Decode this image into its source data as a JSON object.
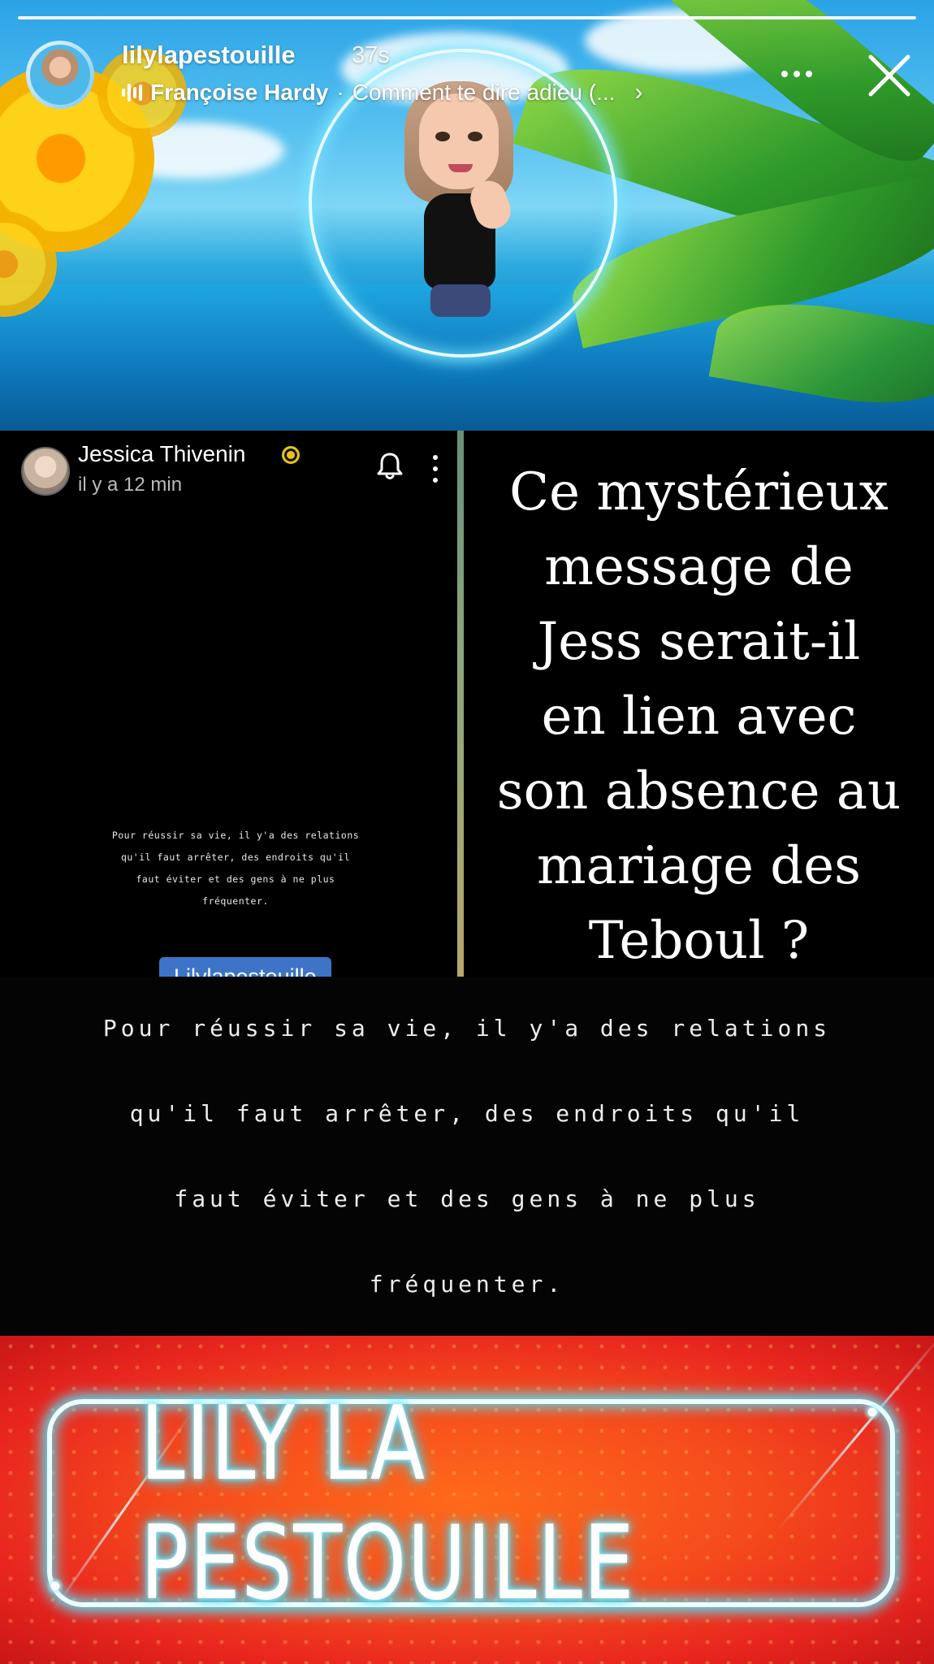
{
  "story": {
    "username": "lilylapestouille",
    "time_ago": "37s",
    "music": {
      "artist": "Françoise Hardy",
      "separator": "·",
      "title": "Comment te dire adieu (...",
      "chevron": "›"
    },
    "progress": 1.0
  },
  "snap_post": {
    "author": "Jessica Thivenin",
    "time": "il y a 12 min",
    "quote_lines": [
      "Pour réussir sa vie, il y'a des relations",
      "qu'il faut arrêter, des endroits qu'il",
      "faut éviter et des gens à ne plus",
      "fréquenter."
    ],
    "tag": "Lilylapestouille"
  },
  "headline": {
    "lines": [
      "Ce mystérieux",
      "message de",
      "Jess serait-il",
      "en lien avec",
      "son absence au",
      "mariage des",
      "Teboul ?"
    ]
  },
  "zoom_quote": {
    "lines": [
      "Pour réussir sa vie, il y'a des relations",
      "qu'il faut arrêter, des endroits qu'il",
      "faut éviter et des gens à ne plus",
      "fréquenter."
    ]
  },
  "footer": {
    "neon_text": "LILY LA PESTOUILLE"
  },
  "icons": {
    "music": "audio-bars-icon",
    "more": "more-horizontal-icon",
    "close": "close-icon",
    "bell": "bell-icon",
    "kebab": "more-vertical-icon",
    "verified": "verified-badge-icon"
  },
  "colors": {
    "tag_bg": "#3d74c7",
    "neon": "#39d9ff",
    "footer": "#f54a1c",
    "verified": "#e6c21a"
  }
}
